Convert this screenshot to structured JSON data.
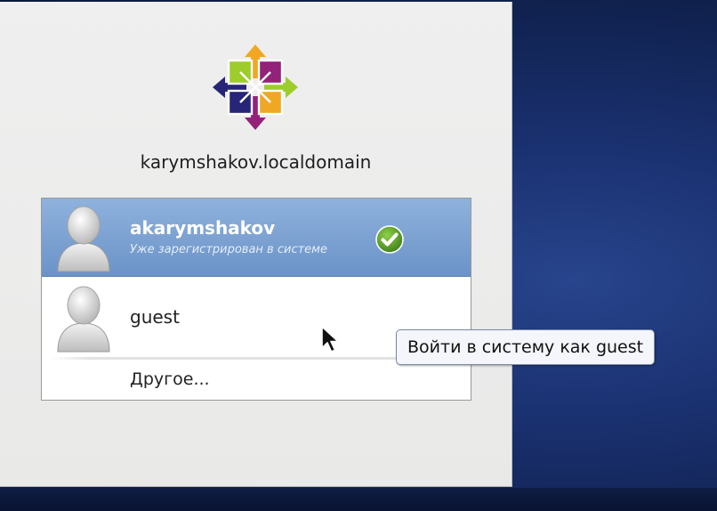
{
  "login": {
    "hostname": "karymshakov.localdomain",
    "logo_icon": "centos-logo-icon",
    "users": [
      {
        "name": "akarymshakov",
        "status": "Уже зарегистрирован в системе",
        "selected": true,
        "avatar_icon": "user-avatar-icon",
        "badge_icon": "check-icon"
      },
      {
        "name": "guest",
        "selected": false,
        "avatar_icon": "user-avatar-icon"
      }
    ],
    "other_label": "Другое..."
  },
  "tooltip": {
    "text": "Войти в систему как guest"
  },
  "colors": {
    "selection": "#7a9fd0",
    "background": "#1a3170",
    "panel": "#ececeb",
    "check_green": "#4c8f20"
  }
}
